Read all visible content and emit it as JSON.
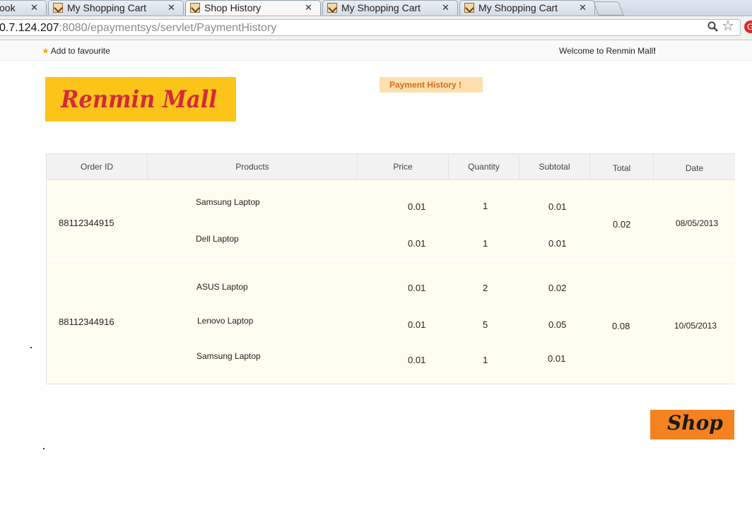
{
  "browser": {
    "tabs": [
      {
        "title": "ook",
        "active": false
      },
      {
        "title": "My Shopping Cart",
        "active": false
      },
      {
        "title": "Shop History",
        "active": true
      },
      {
        "title": "My Shopping Cart",
        "active": false
      },
      {
        "title": "My Shopping Cart",
        "active": false
      }
    ],
    "url_host": "0.7.124.207",
    "url_rest": ":8080/epaymentsys/servlet/PaymentHistory"
  },
  "topbar": {
    "favourite_label": "Add to favourite",
    "welcome_text": "Welcome to Renmin Mall",
    "welcome_mark": "!"
  },
  "logo_text": "Renmin Mall",
  "page_badge": "Payment History !",
  "table": {
    "headers": [
      "Order ID",
      "Products",
      "Price",
      "Quantity",
      "Subtotal",
      "Total",
      "Date"
    ],
    "orders": [
      {
        "order_id": "88112344915",
        "total": "0.02",
        "date": "08/05/2013",
        "items": [
          {
            "product": "Samsung Laptop",
            "price": "0.01",
            "quantity": "1",
            "subtotal": "0.01"
          },
          {
            "product": "Dell Laptop",
            "price": "0.01",
            "quantity": "1",
            "subtotal": "0.01"
          }
        ]
      },
      {
        "order_id": "88112344916",
        "total": "0.08",
        "date": "10/05/2013",
        "items": [
          {
            "product": "ASUS Laptop",
            "price": "0.01",
            "quantity": "2",
            "subtotal": "0.02"
          },
          {
            "product": "Lenovo Laptop",
            "price": "0.01",
            "quantity": "5",
            "subtotal": "0.05"
          },
          {
            "product": "Samsung  Laptop",
            "price": "0.01",
            "quantity": "1",
            "subtotal": "0.01"
          }
        ]
      }
    ]
  },
  "shop_button_label": "Shop",
  "colors": {
    "logo_bg": "#fcc419",
    "logo_text": "#d42a39",
    "badge_bg": "#fde0ae",
    "badge_text": "#d96b17",
    "row_bg": "#fefdf0",
    "shop_button_bg": "#f58220"
  }
}
